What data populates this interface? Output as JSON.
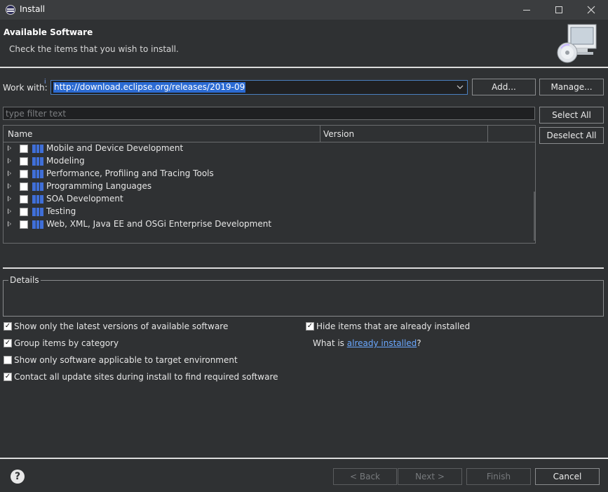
{
  "window": {
    "title": "Install"
  },
  "banner": {
    "title": "Available Software",
    "subtitle": "Check the items that you wish to install."
  },
  "work_with": {
    "label": "Work with:",
    "info_marker": "i",
    "value": "http://download.eclipse.org/releases/2019-09",
    "add_label": "Add...",
    "manage_label": "Manage..."
  },
  "filter": {
    "placeholder": "type filter text",
    "select_all_label": "Select All",
    "deselect_all_label": "Deselect All"
  },
  "table": {
    "columns": [
      "Name",
      "Version"
    ],
    "rows": [
      {
        "label": "Mobile and Device Development",
        "checked": false
      },
      {
        "label": "Modeling",
        "checked": false
      },
      {
        "label": "Performance, Profiling and Tracing Tools",
        "checked": false
      },
      {
        "label": "Programming Languages",
        "checked": false
      },
      {
        "label": "SOA Development",
        "checked": false
      },
      {
        "label": "Testing",
        "checked": false
      },
      {
        "label": "Web, XML, Java EE and OSGi Enterprise Development",
        "checked": false
      }
    ]
  },
  "details": {
    "label": "Details"
  },
  "options": {
    "latest_versions": {
      "label": "Show only the latest versions of available software",
      "checked": true
    },
    "group_by_category": {
      "label": "Group items by category",
      "checked": true
    },
    "target_environment": {
      "label": "Show only software applicable to target environment",
      "checked": false
    },
    "contact_update_sites": {
      "label": "Contact all update sites during install to find required software",
      "checked": true
    },
    "hide_installed": {
      "label": "Hide items that are already installed",
      "checked": true
    },
    "what_is_prefix": "What is ",
    "already_installed_link": "already installed",
    "what_is_suffix": "?"
  },
  "footer": {
    "help_glyph": "?",
    "back_label": "< Back",
    "next_label": "Next >",
    "finish_label": "Finish",
    "cancel_label": "Cancel"
  },
  "colors": {
    "background": "#2f3133",
    "selection": "#2b6bd3",
    "link": "#6aa8ff",
    "category_icon": "#3f6fd8"
  }
}
